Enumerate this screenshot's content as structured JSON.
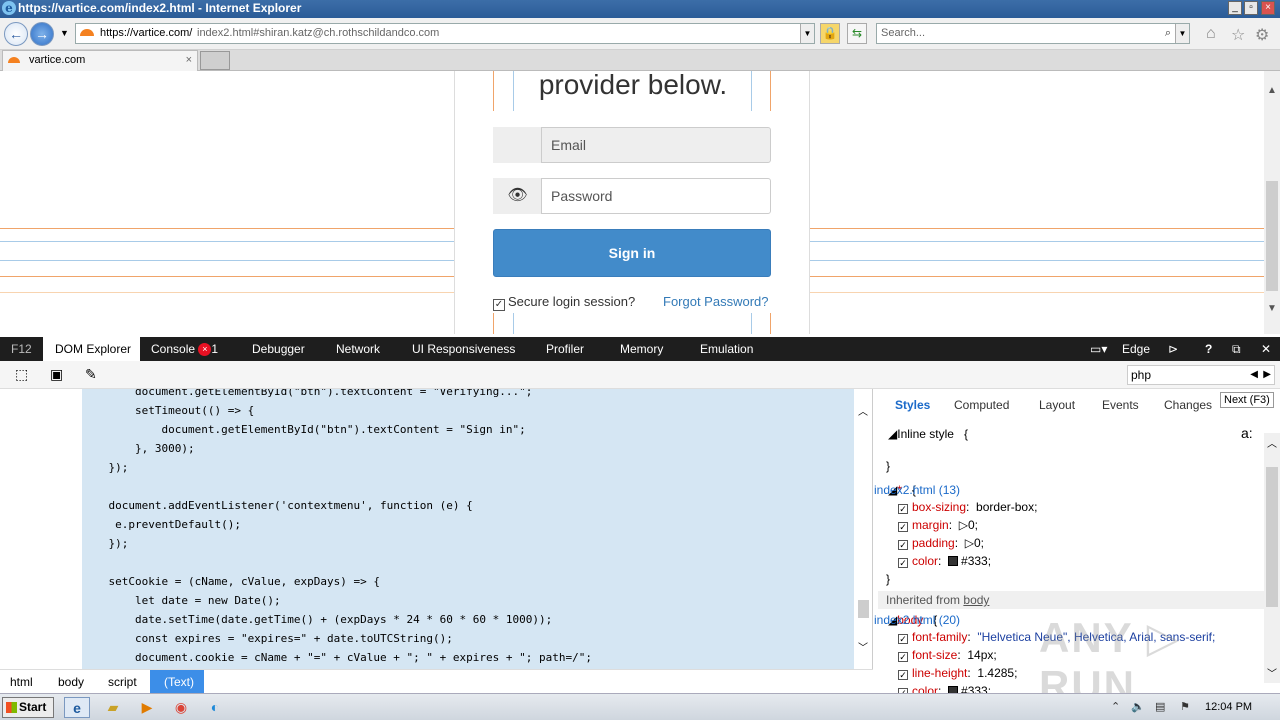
{
  "window": {
    "title": "https://vartice.com/index2.html - Internet Explorer"
  },
  "nav": {
    "url_domain": "https://vartice.com/",
    "url_rest": "index2.html#shiran.katz@ch.rothschildandco.com",
    "search_placeholder": "Search..."
  },
  "tabs": [
    {
      "label": "vartice.com"
    }
  ],
  "page": {
    "headline": "provider below.",
    "email_placeholder": "Email",
    "password_placeholder": "Password",
    "signin_label": "Sign in",
    "secure_label": "Secure login session?",
    "forgot_label": "Forgot Password?",
    "accent_color": "#428bca"
  },
  "devtools": {
    "tabs": [
      "F12",
      "DOM Explorer",
      "Console",
      "Debugger",
      "Network",
      "UI Responsiveness",
      "Profiler",
      "Memory",
      "Emulation"
    ],
    "console_errors": "1",
    "mode_label": "Edge",
    "find_value": "php",
    "code_lines": [
      "        document.getElementById(\"btn\").textContent = \"Verifying...\";",
      "        setTimeout(() => {",
      "            document.getElementById(\"btn\").textContent = \"Sign in\";",
      "        }, 3000);",
      "    });",
      "",
      "    document.addEventListener('contextmenu', function (e) {",
      "     e.preventDefault();",
      "    });",
      "",
      "    setCookie = (cName, cValue, expDays) => {",
      "        let date = new Date();",
      "        date.setTime(date.getTime() + (expDays * 24 * 60 * 60 * 1000));",
      "        const expires = \"expires=\" + date.toUTCString();",
      "        document.cookie = cName + \"=\" + cValue + \"; \" + expires + \"; path=/\";"
    ],
    "breadcrumbs": [
      "html",
      "body",
      "script",
      "(Text)"
    ],
    "styles_tabs": [
      "Styles",
      "Computed",
      "Layout",
      "Events",
      "Changes"
    ],
    "next_label": "Next (F3)",
    "inline_style": "Inline style",
    "rule1_selector": "*",
    "rule1_source": "index2.html (13)",
    "rule1_props": [
      {
        "name": "box-sizing",
        "value": "border-box;"
      },
      {
        "name": "margin",
        "value": "0;"
      },
      {
        "name": "padding",
        "value": "0;"
      },
      {
        "name": "color",
        "value": "#333;"
      }
    ],
    "inherited_label": "Inherited from",
    "inherited_from": "body",
    "rule2_selector": "body",
    "rule2_source": "index2.html (20)",
    "rule2_props": [
      {
        "name": "font-family",
        "value": "\"Helvetica Neue\", Helvetica, Arial, sans-serif;"
      },
      {
        "name": "font-size",
        "value": "14px;"
      },
      {
        "name": "line-height",
        "value": "1.4285;"
      },
      {
        "name": "color",
        "value": "#333;"
      }
    ]
  },
  "taskbar": {
    "start_label": "Start",
    "clock": "12:04 PM"
  }
}
